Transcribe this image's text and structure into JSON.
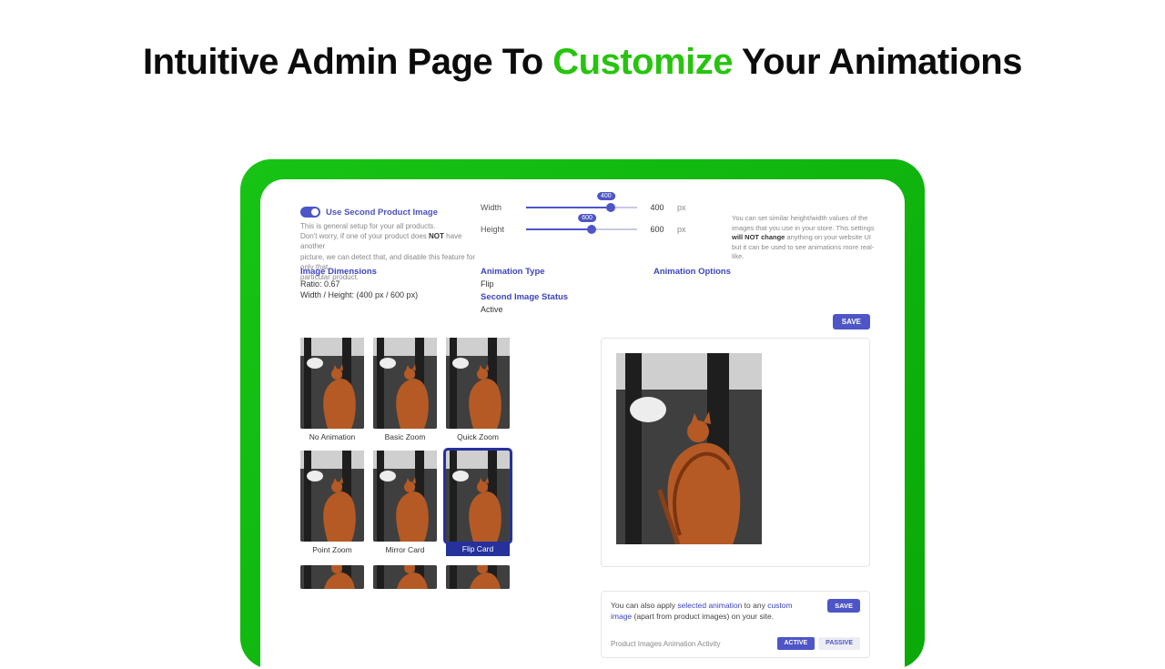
{
  "hero": {
    "pre": "Intuitive Admin Page To ",
    "accent": "Customize",
    "post": " Your Animations"
  },
  "toggle": {
    "label": "Use Second Product Image"
  },
  "help": {
    "line1": "This is general setup for your all products.",
    "line2a": "Don't worry, if one of your product does ",
    "line2b": "NOT",
    "line2c": " have another",
    "line3": "picture, we can detect that, and disable this feature for only that",
    "line4": "particular product."
  },
  "sliders": {
    "width": {
      "label": "Width",
      "value": "400",
      "unit": "px",
      "tip": "400",
      "pct": 72
    },
    "height": {
      "label": "Height",
      "value": "600",
      "unit": "px",
      "tip": "600",
      "pct": 55
    }
  },
  "desc_right": {
    "t1": "You can set similar height/width values of the images that you use in your store. This settings ",
    "bold1": "will NOT change",
    "t2": " anything on your website UI but it can be used to see animations more real-like."
  },
  "sections": {
    "image_dimensions": {
      "title": "Image Dimensions",
      "ratio_label": "Ratio: ",
      "ratio_value": "0.67",
      "wh_line": "Width / Height: (400 px / 600 px)"
    },
    "animation_type": {
      "title": "Animation Type",
      "value": "Flip",
      "second_title": "Second Image Status",
      "second_value": "Active"
    },
    "animation_options": {
      "title": "Animation Options"
    }
  },
  "save_label": "SAVE",
  "animations": [
    {
      "label": "No Animation",
      "selected": false
    },
    {
      "label": "Basic Zoom",
      "selected": false
    },
    {
      "label": "Quick Zoom",
      "selected": false
    },
    {
      "label": "Point Zoom",
      "selected": false
    },
    {
      "label": "Mirror Card",
      "selected": false
    },
    {
      "label": "Flip Card",
      "selected": true
    },
    {
      "label": "",
      "selected": false
    },
    {
      "label": "",
      "selected": false
    },
    {
      "label": "",
      "selected": false
    }
  ],
  "bottom_note": {
    "t1": "You can also apply ",
    "link1": "selected animation",
    "t2": " to any ",
    "link2": "custom image",
    "t3": " (apart from product images) on your site.",
    "save": "SAVE",
    "footer_title": "Product Images Animation Activity",
    "tab_active": "ACTIVE",
    "tab_passive": "PASSIVE"
  }
}
